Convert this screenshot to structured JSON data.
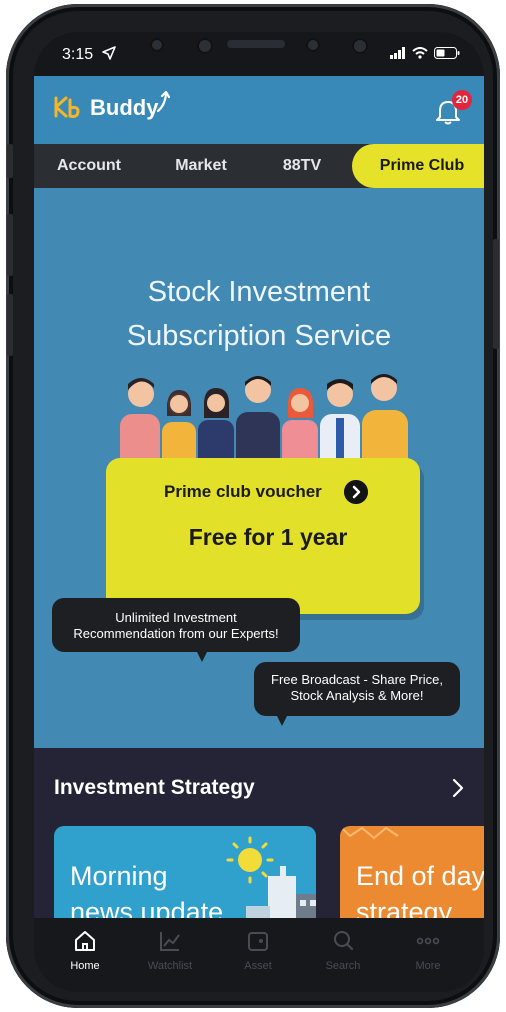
{
  "status_bar": {
    "time": "3:15"
  },
  "header": {
    "logo_text": "Buddy",
    "notification_count": "20"
  },
  "tabs": [
    {
      "label": "Account"
    },
    {
      "label": "Market"
    },
    {
      "label": "88TV"
    },
    {
      "label": "Prime Club"
    }
  ],
  "hero": {
    "title_line1": "Stock Investment",
    "title_line2": "Subscription Service",
    "voucher_label": "Prime club voucher",
    "voucher_value": "Free for 1 year",
    "bubble1_line1": "Unlimited Investment",
    "bubble1_line2": "Recommendation from our Experts!",
    "bubble2_line1": "Free Broadcast - Share Price,",
    "bubble2_line2": "Stock Analysis & More!"
  },
  "strategy": {
    "title": "Investment Strategy",
    "cards": [
      {
        "line1": "Morning",
        "line2": "news update"
      },
      {
        "line1": "End of day",
        "line2": "strategy"
      }
    ]
  },
  "bottom_nav": [
    {
      "label": "Home",
      "icon": "home-icon"
    },
    {
      "label": "Watchlist",
      "icon": "chart-icon"
    },
    {
      "label": "Asset",
      "icon": "wallet-icon"
    },
    {
      "label": "Search",
      "icon": "search-icon"
    },
    {
      "label": "More",
      "icon": "more-icon"
    }
  ],
  "colors": {
    "header_blue": "#3889b7",
    "hero_blue": "#4289b4",
    "accent_yellow": "#e3e02a",
    "strategy_bg": "#242436",
    "badge_red": "#e0263d"
  }
}
